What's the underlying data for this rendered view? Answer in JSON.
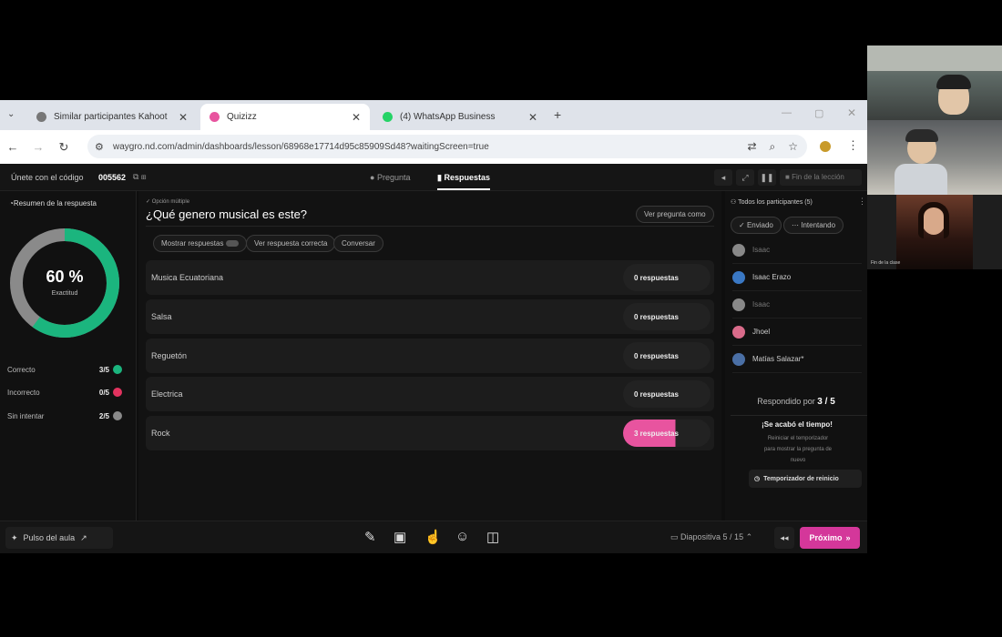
{
  "browser": {
    "tabs": [
      {
        "label": "Similar participantes Kahoot",
        "color": "#777"
      },
      {
        "label": "Quizizz",
        "color": "#e8549f"
      },
      {
        "label": "(4) WhatsApp Business",
        "color": "#25d366"
      }
    ],
    "url": "waygro.nd.com/admin/dashboards/lesson/68968e17714d95c85909Sd48?waitingScreen=true"
  },
  "header": {
    "join_label": "Únete con el código",
    "join_code": "005562",
    "tab_question": "Pregunta",
    "tab_responses": "Respuestas",
    "end_session": "Fin de la lección"
  },
  "summary": {
    "title": "Resumen de la respuesta",
    "percent": "60 %",
    "percent_sub": "Exactitud",
    "percent_value": 0.6,
    "correct_label": "Correcto",
    "correct_value": "3/5",
    "incorrect_label": "Incorrecto",
    "incorrect_value": "0/5",
    "unattempted_label": "Sin intentar",
    "unattempted_value": "2/5",
    "colors": {
      "correct": "#1bb57e",
      "incorrect": "#e2335f",
      "unattempted": "#8a8a8a"
    }
  },
  "question": {
    "kicker": "Opción múltiple",
    "title": "¿Qué genero musical es este?",
    "view_question": "Ver pregunta como",
    "controls": {
      "show_responses": "Mostrar respuestas",
      "show_correct": "Ver respuesta correcta",
      "converse": "Conversar"
    },
    "answers": [
      {
        "label": "Musica Ecuatoriana",
        "count": "0 respuestas"
      },
      {
        "label": "Salsa",
        "count": "0 respuestas"
      },
      {
        "label": "Reguetón",
        "count": "0 respuestas"
      },
      {
        "label": "Electrica",
        "count": "0 respuestas"
      },
      {
        "label": "Rock",
        "count": "3 respuestas"
      }
    ]
  },
  "participants": {
    "title": "Todos los participantes (5)",
    "filter_done": "Enviado",
    "filter_trying": "Intentando",
    "list": [
      "Isaac",
      "Isaac Erazo",
      "Isaac",
      "Jhoel",
      "Matías Salazar*"
    ],
    "answered_prefix": "Respondido por",
    "answered_value": "3 / 5",
    "time_up": "¡Se acabó el tiempo!",
    "time_up_sub": "Reiniciar el temporizador para mostrar la pregunta de nuevo",
    "restart_button": "Temporizador de reinicio"
  },
  "bottom": {
    "pulse": "Pulso del aula",
    "slide_status": "Diapositiva 5 / 15",
    "next": "Próximo"
  },
  "video": {
    "caption": "Fin de la clase"
  }
}
